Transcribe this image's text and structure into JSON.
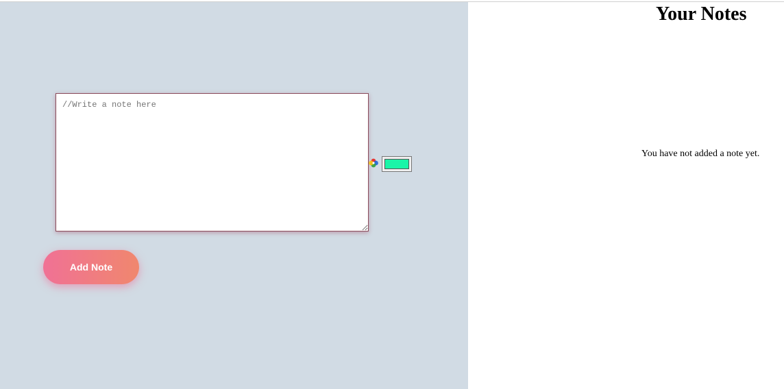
{
  "editor": {
    "placeholder": "//Write a note here",
    "value": ""
  },
  "color_picker": {
    "icon": "color-wheel-icon",
    "selected_color": "#1af5a8"
  },
  "actions": {
    "add_label": "Add Note"
  },
  "notes_panel": {
    "title": "Your Notes",
    "empty_message": "You have not added a note yet."
  },
  "theme": {
    "left_background": "#d1dbe4",
    "button_gradient_start": "#f07195",
    "button_gradient_end": "#f0876e"
  }
}
